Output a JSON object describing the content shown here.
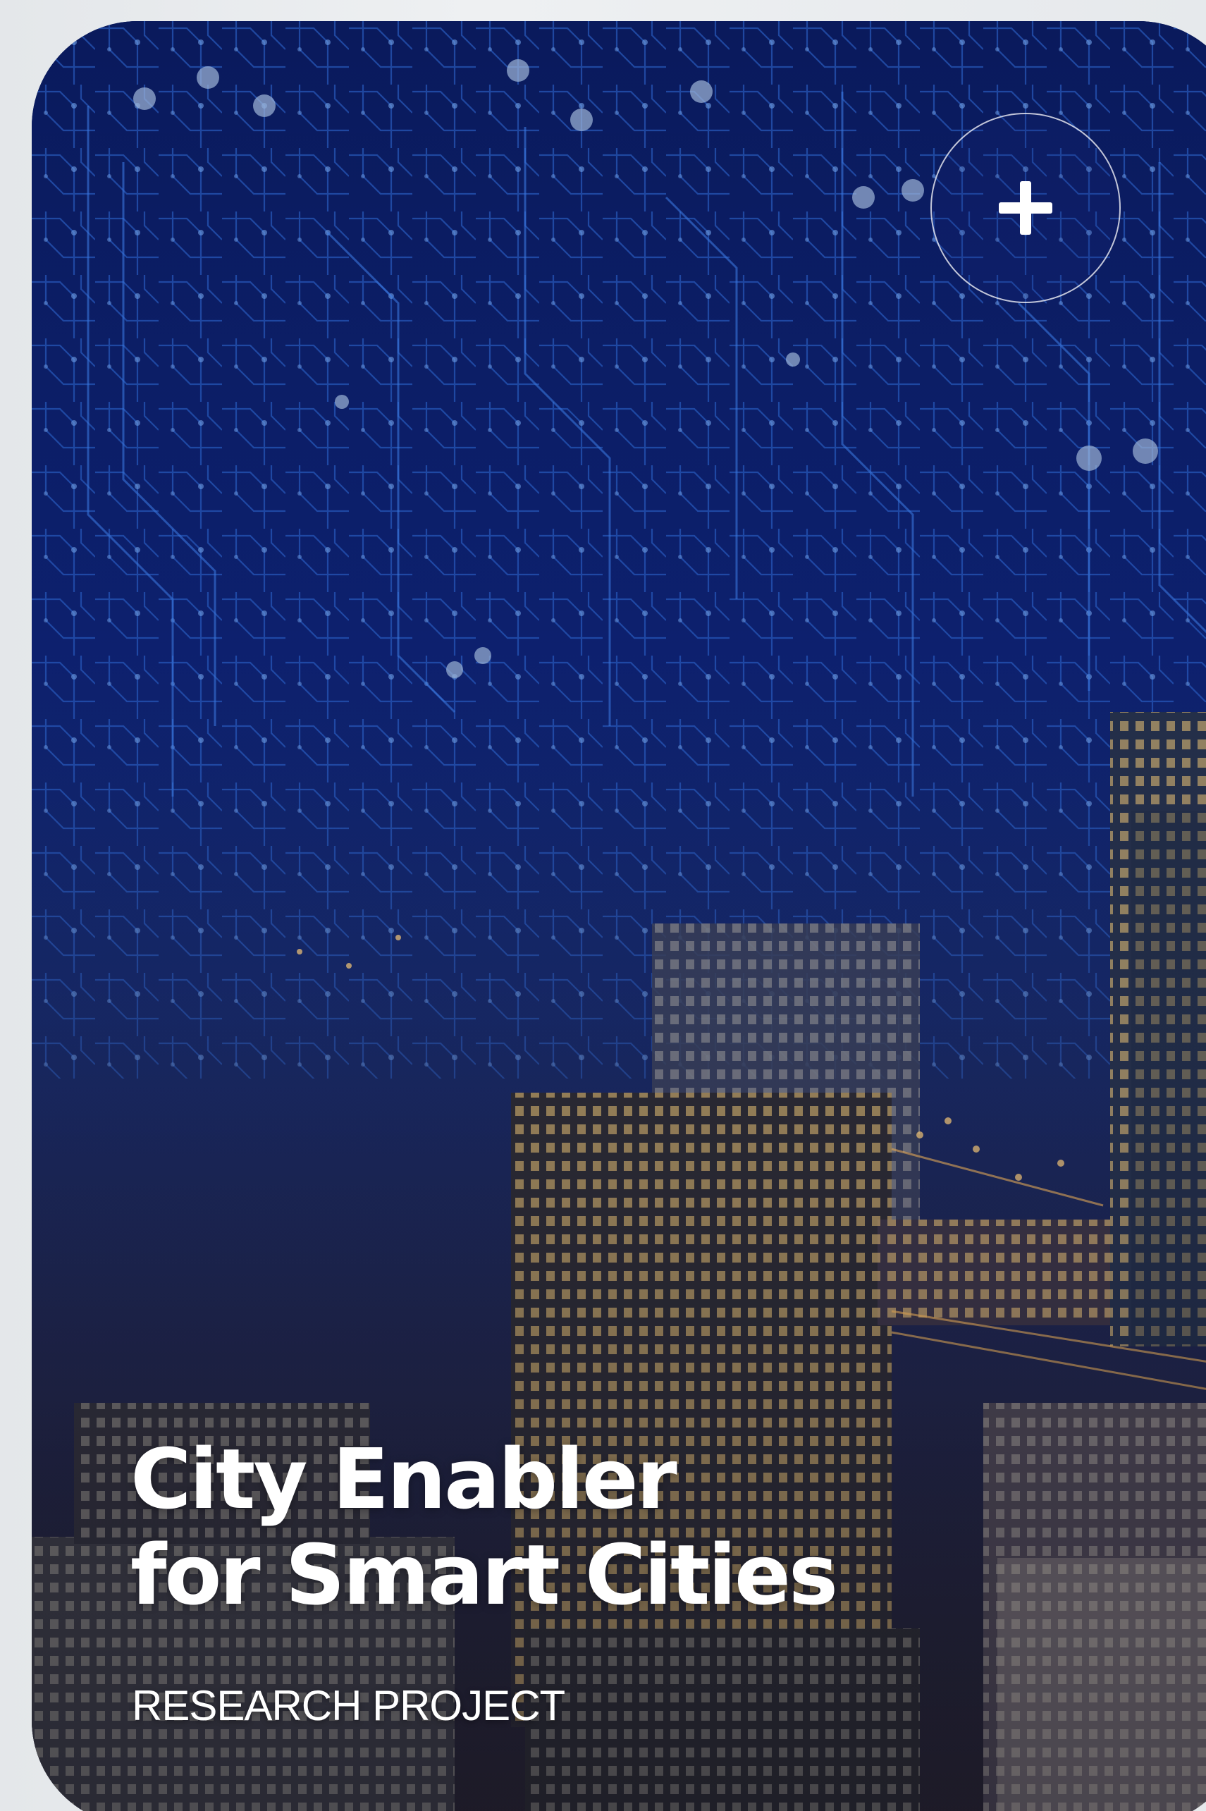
{
  "card": {
    "title_line1": "City Enabler",
    "title_line2": "for Smart Cities",
    "subtitle": "RESEARCH PROJECT",
    "expand_icon": "plus-icon"
  },
  "colors": {
    "circuit_blue": "#0d1f6b",
    "trace_blue": "#2a62c9",
    "city_lights": "#f2c66a",
    "text": "#ffffff"
  }
}
